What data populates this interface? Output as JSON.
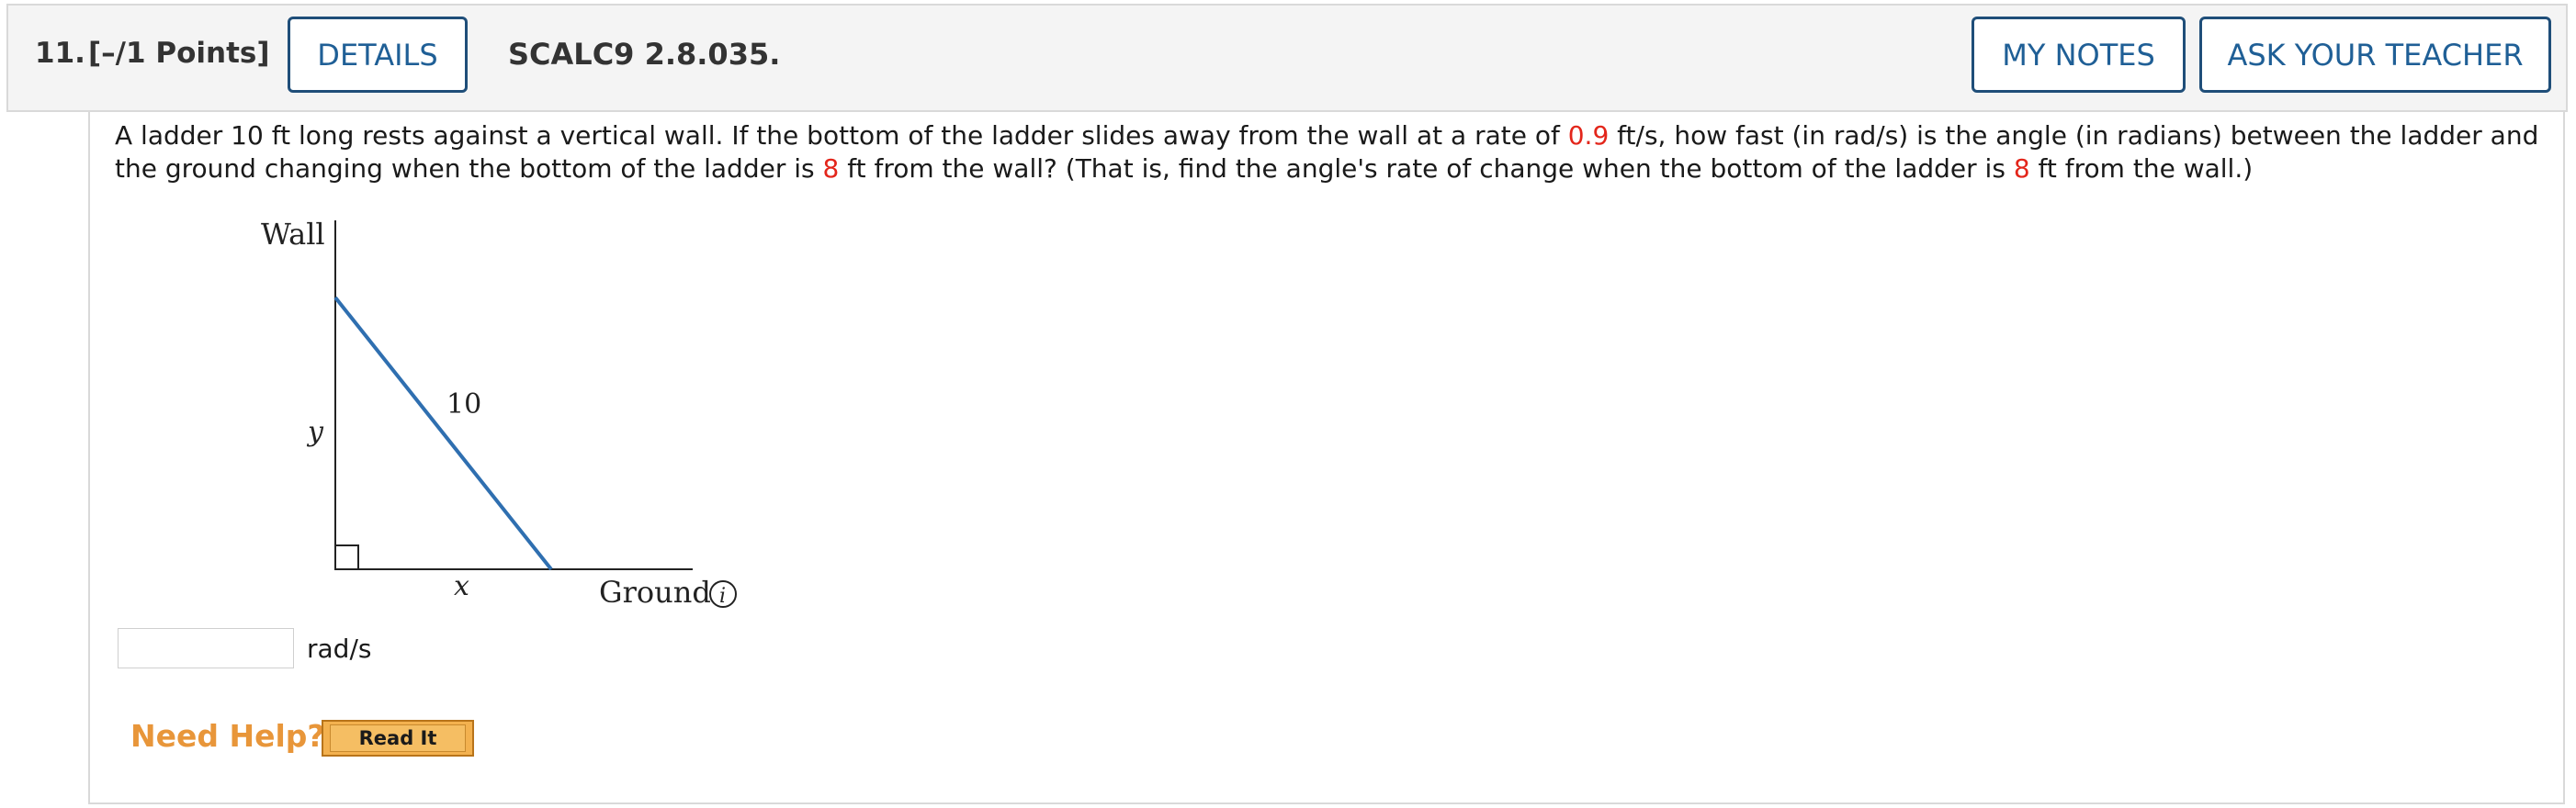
{
  "header": {
    "number": "11.",
    "points": "[–/1 Points]",
    "details_label": "DETAILS",
    "problem_id": "SCALC9 2.8.035.",
    "my_notes_label": "MY NOTES",
    "ask_teacher_label": "ASK YOUR TEACHER"
  },
  "question": {
    "p1": "A ladder 10 ft long rests against a vertical wall. If the bottom of the ladder slides away from the wall at a rate of ",
    "rate": "0.9",
    "p2": " ft/s, how fast (in rad/s) is the angle (in radians) between the ladder and the ground changing when the bottom of the ladder is ",
    "dist1": "8",
    "p3": " ft from the wall? (That is, find the angle's rate of change when the bottom of the ladder is ",
    "dist2": "8",
    "p4": " ft from the wall.)"
  },
  "figure": {
    "wall_label": "Wall",
    "ladder_label": "10",
    "y_label": "y",
    "x_label": "x",
    "ground_label": "Ground",
    "info_glyph": "i"
  },
  "answer": {
    "value": "",
    "placeholder": "",
    "units": "rad/s"
  },
  "help": {
    "need_help": "Need Help?",
    "read_it_label": "Read It"
  },
  "colors": {
    "accent_blue": "#1f5f96",
    "highlight_red": "#e3261b",
    "help_orange": "#e8963a",
    "ladder_blue": "#2f6fb0"
  }
}
